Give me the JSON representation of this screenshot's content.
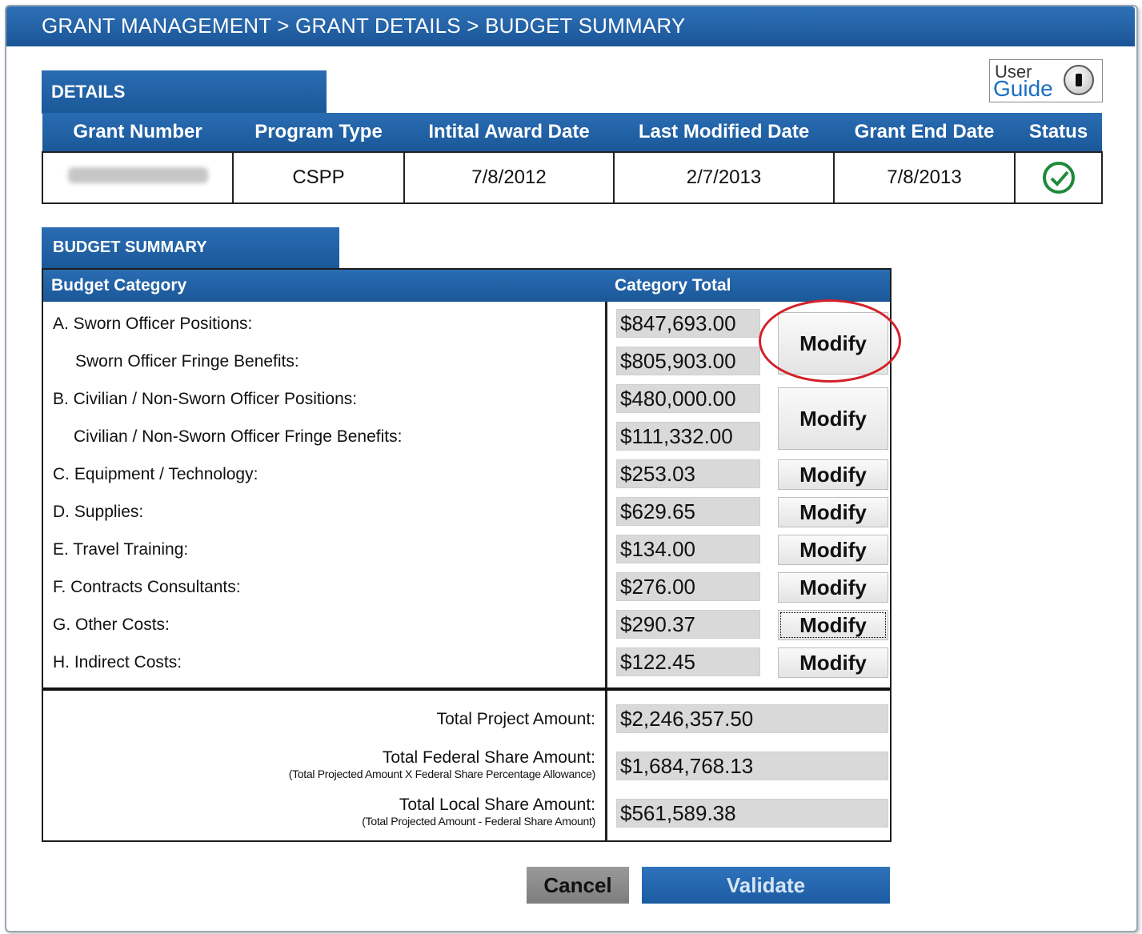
{
  "breadcrumb": "GRANT MANAGEMENT > GRANT DETAILS > BUDGET SUMMARY",
  "details": {
    "tab_label": "DETAILS",
    "headers": [
      "Grant Number",
      "Program Type",
      "Intital Award Date",
      "Last Modified Date",
      "Grant End Date",
      "Status"
    ],
    "row": {
      "program_type": "CSPP",
      "initial_award_date": "7/8/2012",
      "last_modified_date": "2/7/2013",
      "grant_end_date": "7/8/2013",
      "status_icon": "check-circle-icon"
    }
  },
  "user_guide": {
    "line1": "User",
    "line2": "Guide"
  },
  "budget": {
    "tab_label": "BUDGET SUMMARY",
    "col_category": "Budget Category",
    "col_total": "Category Total",
    "rows": [
      {
        "label": "A. Sworn Officer Positions:",
        "amount": "$847,693.00"
      },
      {
        "label": "Sworn Officer Fringe Benefits:",
        "amount": "$805,903.00"
      },
      {
        "label": "B. Civilian / Non-Sworn Officer Positions:",
        "amount": "$480,000.00"
      },
      {
        "label": "Civilian / Non-Sworn Officer Fringe Benefits:",
        "amount": "$111,332.00"
      },
      {
        "label": "C. Equipment / Technology:",
        "amount": "$253.03"
      },
      {
        "label": "D. Supplies:",
        "amount": "$629.65"
      },
      {
        "label": "E. Travel Training:",
        "amount": "$134.00"
      },
      {
        "label": "F. Contracts Consultants:",
        "amount": "$276.00"
      },
      {
        "label": "G. Other Costs:",
        "amount": "$290.37"
      },
      {
        "label": "H. Indirect Costs:",
        "amount": "$122.45"
      }
    ],
    "modify_label": "Modify",
    "totals": {
      "project_label": "Total Project Amount:",
      "project_amount": "$2,246,357.50",
      "federal_label": "Total Federal Share Amount:",
      "federal_note": "(Total Projected Amount X Federal Share Percentage Allowance)",
      "federal_amount": "$1,684,768.13",
      "local_label": "Total Local Share Amount:",
      "local_note": "(Total Projected Amount - Federal Share Amount)",
      "local_amount": "$561,589.38"
    }
  },
  "actions": {
    "cancel": "Cancel",
    "validate": "Validate"
  },
  "colors": {
    "header_blue": "#1a5898",
    "highlight_red": "#d4202a",
    "status_green": "#1e8a3a"
  }
}
